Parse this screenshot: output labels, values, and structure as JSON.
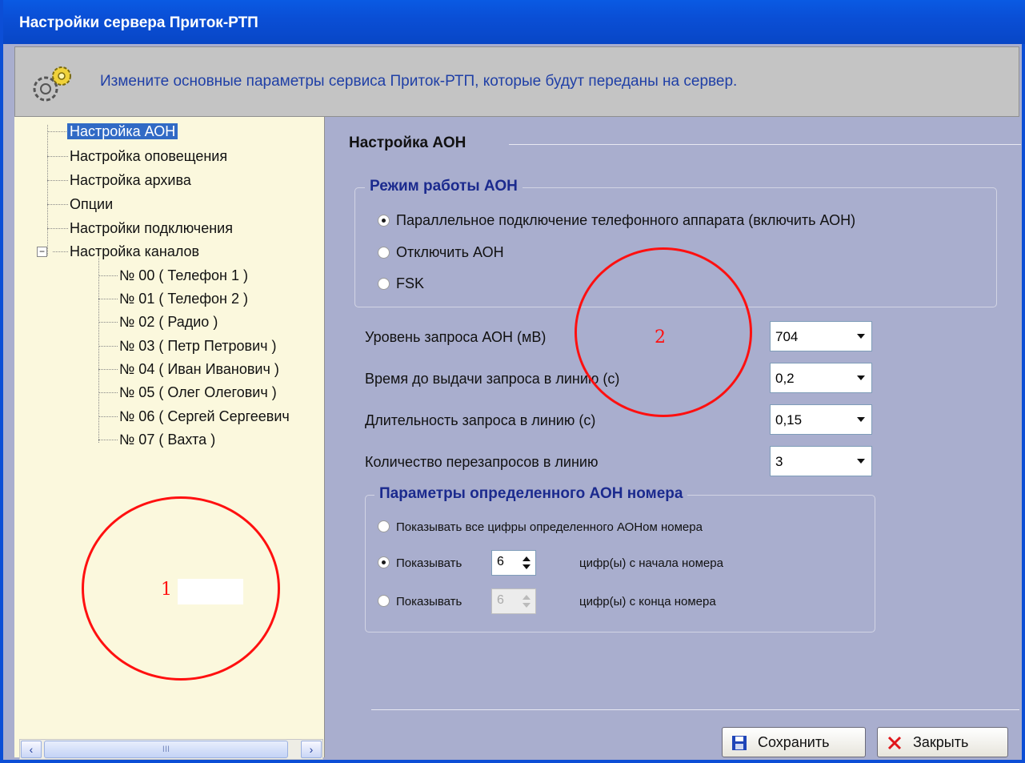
{
  "window": {
    "title": "Настройки сервера Приток-РТП"
  },
  "header": {
    "text": "Измените основные параметры сервиса Приток-РТП, которые будут переданы на сервер."
  },
  "tree": {
    "items": [
      "Настройка АОН",
      "Настройка оповещения",
      "Настройка архива",
      "Опции",
      "Настройки подключения",
      "Настройка каналов"
    ],
    "channels": [
      "№ 00 ( Телефон 1 )",
      "№ 01 ( Телефон 2 )",
      "№ 02 ( Радио )",
      "№ 03 ( Петр Петрович )",
      "№ 04 ( Иван Иванович )",
      "№ 05 ( Олег Олегович )",
      "№ 06 ( Сергей Сергеевич",
      "№ 07 ( Вахта )"
    ],
    "scroll_thumb": "III"
  },
  "panel": {
    "title": "Настройка АОН",
    "mode_group": {
      "title": "Режим работы АОН",
      "options": [
        "Параллельное подключение телефонного аппарата (включить АОН)",
        "Отключить АОН",
        "FSK"
      ]
    },
    "fields": [
      {
        "label": "Уровень запроса АОН (мВ)",
        "value": "704"
      },
      {
        "label": "Время до выдачи запроса в линию (с)",
        "value": "0,2"
      },
      {
        "label": "Длительность запроса в линию (с)",
        "value": "0,15"
      },
      {
        "label": "Количество перезапросов в линию",
        "value": "3"
      }
    ],
    "number_group": {
      "title": "Параметры определенного АОН номера",
      "all_digits": "Показывать все цифры определенного АОНом номера",
      "show_label": "Показывать",
      "start_value": "6",
      "start_suffix": "цифр(ы) с начала номера",
      "end_value": "6",
      "end_suffix": "цифр(ы) с конца номера"
    },
    "save_label": "Сохранить",
    "close_label": "Закрыть"
  },
  "annotations": {
    "one": "1",
    "two": "2"
  },
  "colors": {
    "annotation": "#ff1010",
    "selection": "#316ac5",
    "titlebar": "#0a5ae3"
  }
}
